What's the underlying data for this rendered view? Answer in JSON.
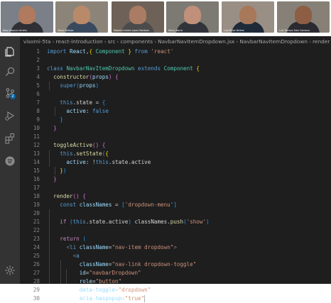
{
  "participants": [
    {
      "name": "Rosa Vasquez Arrieta",
      "bg": "#7a7f88",
      "skin": "#b07a5e",
      "shirt": "#2f2f35"
    },
    {
      "name": "Oscar Vallejos",
      "bg": "#8c8478",
      "skin": "#b98a6a",
      "shirt": "#3a4a5e"
    },
    {
      "name": "Roberto Andres Lopez Montano",
      "bg": "#6e6258",
      "skin": "#a97c63",
      "shirt": "#4b4b4b"
    },
    {
      "name": "Henry Ibarra",
      "bg": "#7d7a73",
      "skin": "#c0907a",
      "shirt": "#30343a"
    },
    {
      "name": "Luis Felipe Beltran",
      "bg": "#9a8f85",
      "skin": "#a8785b",
      "shirt": "#1f2a38"
    },
    {
      "name": "Luis Tamayo Soto Carrasco",
      "bg": "#868077",
      "skin": "#8d5e44",
      "shirt": "#2a2a30"
    }
  ],
  "breadcrumb": [
    "visomi-5ta",
    "react-introduction",
    "src",
    "components",
    "NavbarNavItemDropdown.jsx",
    "NavbarNavItemDropdown",
    "render"
  ],
  "activity_bar": [
    "files-icon",
    "search-icon",
    "source-control-icon",
    "run-debug-icon",
    "extensions-icon",
    "spotify-icon",
    "settings-gear-icon"
  ],
  "source_control_badge": "2",
  "code_lines": [
    {
      "n": "1",
      "tokens": [
        [
          "kw",
          "import "
        ],
        [
          "var",
          "React"
        ],
        [
          "",
          ","
        ],
        [
          "br1",
          "{ "
        ],
        [
          "cls",
          "Component"
        ],
        [
          "br1",
          " }"
        ],
        [
          "kw",
          " from "
        ],
        [
          "str",
          "'react'"
        ]
      ]
    },
    {
      "n": "2",
      "tokens": []
    },
    {
      "n": "3",
      "tokens": [
        [
          "kw",
          "class "
        ],
        [
          "cls",
          "NavbarNavItemDropdown"
        ],
        [
          "kw",
          " extends "
        ],
        [
          "cls",
          "Component"
        ],
        [
          "br1",
          " {"
        ]
      ]
    },
    {
      "n": "4",
      "tokens": [
        [
          "",
          "  "
        ],
        [
          "fn",
          "constructor"
        ],
        [
          "br2",
          "("
        ],
        [
          "var",
          "props"
        ],
        [
          "br2",
          ")"
        ],
        [
          "br2",
          " {"
        ]
      ]
    },
    {
      "n": "5",
      "tokens": [
        [
          "",
          "    "
        ],
        [
          "kw",
          "super"
        ],
        [
          "br3",
          "("
        ],
        [
          "var",
          "props"
        ],
        [
          "br3",
          ")"
        ]
      ]
    },
    {
      "n": "6",
      "tokens": []
    },
    {
      "n": "7",
      "tokens": [
        [
          "",
          "    "
        ],
        [
          "kw",
          "this"
        ],
        [
          "",
          ".state = "
        ],
        [
          "br3",
          "{"
        ]
      ]
    },
    {
      "n": "8",
      "tokens": [
        [
          "",
          "      "
        ],
        [
          "var",
          "active"
        ],
        [
          "",
          ": "
        ],
        [
          "kw",
          "false"
        ]
      ]
    },
    {
      "n": "9",
      "tokens": [
        [
          "",
          "    "
        ],
        [
          "br3",
          "}"
        ]
      ]
    },
    {
      "n": "10",
      "tokens": [
        [
          "",
          "  "
        ],
        [
          "br2",
          "}"
        ]
      ]
    },
    {
      "n": "11",
      "tokens": []
    },
    {
      "n": "12",
      "tokens": [
        [
          "",
          "  "
        ],
        [
          "fn",
          "toggleActive"
        ],
        [
          "br2",
          "()"
        ],
        [
          "br2",
          " {"
        ]
      ]
    },
    {
      "n": "13",
      "tokens": [
        [
          "",
          "    "
        ],
        [
          "kw",
          "this"
        ],
        [
          "",
          "."
        ],
        [
          "fn",
          "setState"
        ],
        [
          "br3",
          "("
        ],
        [
          "br1",
          "{"
        ]
      ]
    },
    {
      "n": "14",
      "tokens": [
        [
          "",
          "      "
        ],
        [
          "var",
          "active"
        ],
        [
          "",
          ": !"
        ],
        [
          "kw",
          "this"
        ],
        [
          "",
          ".state.active"
        ]
      ]
    },
    {
      "n": "15",
      "tokens": [
        [
          "",
          "    "
        ],
        [
          "br1",
          "}"
        ],
        [
          "br3",
          ")"
        ]
      ]
    },
    {
      "n": "16",
      "tokens": [
        [
          "",
          "  "
        ],
        [
          "br2",
          "}"
        ]
      ]
    },
    {
      "n": "17",
      "tokens": []
    },
    {
      "n": "18",
      "tokens": [
        [
          "",
          "  "
        ],
        [
          "fn",
          "render"
        ],
        [
          "br2",
          "()"
        ],
        [
          "br2",
          " {"
        ]
      ]
    },
    {
      "n": "19",
      "tokens": [
        [
          "",
          "    "
        ],
        [
          "kw",
          "const "
        ],
        [
          "var",
          "classNames"
        ],
        [
          "",
          " = "
        ],
        [
          "br3",
          "["
        ],
        [
          "str",
          "'dropdown-menu'"
        ],
        [
          "br3",
          "]"
        ]
      ]
    },
    {
      "n": "20",
      "tokens": []
    },
    {
      "n": "21",
      "tokens": [
        [
          "",
          "    "
        ],
        [
          "ctl",
          "if "
        ],
        [
          "br3",
          "("
        ],
        [
          "kw",
          "this"
        ],
        [
          "",
          ".state.active"
        ],
        [
          "br3",
          ")"
        ],
        [
          "",
          " classNames."
        ],
        [
          "fn",
          "push"
        ],
        [
          "br3",
          "("
        ],
        [
          "str",
          "'show'"
        ],
        [
          "br3",
          ")"
        ]
      ]
    },
    {
      "n": "22",
      "tokens": []
    },
    {
      "n": "23",
      "tokens": [
        [
          "",
          "    "
        ],
        [
          "ctl",
          "return "
        ],
        [
          "br3",
          "("
        ]
      ]
    },
    {
      "n": "24",
      "tokens": [
        [
          "",
          "      "
        ],
        [
          "pun",
          "<"
        ],
        [
          "tag",
          "li "
        ],
        [
          "var",
          "className"
        ],
        [
          "",
          "="
        ],
        [
          "str",
          "\"nav-item dropdown\""
        ],
        [
          "pun",
          ">"
        ]
      ]
    },
    {
      "n": "25",
      "tokens": [
        [
          "",
          "        "
        ],
        [
          "pun",
          "<"
        ],
        [
          "tag",
          "a"
        ]
      ]
    },
    {
      "n": "26",
      "tokens": [
        [
          "",
          "          "
        ],
        [
          "var",
          "className"
        ],
        [
          "",
          "="
        ],
        [
          "str",
          "\"nav-link dropdown-toggle\""
        ]
      ]
    },
    {
      "n": "27",
      "tokens": [
        [
          "",
          "          "
        ],
        [
          "var",
          "id"
        ],
        [
          "",
          "="
        ],
        [
          "str",
          "\"navbarDropdown\""
        ]
      ]
    },
    {
      "n": "28",
      "tokens": [
        [
          "",
          "          "
        ],
        [
          "var",
          "role"
        ],
        [
          "",
          "="
        ],
        [
          "str",
          "\"button\""
        ]
      ]
    },
    {
      "n": "29",
      "tokens": [
        [
          "",
          "          "
        ],
        [
          "var",
          "data-toggle"
        ],
        [
          "",
          "="
        ],
        [
          "str",
          "\"dropdown\""
        ]
      ]
    },
    {
      "n": "30",
      "tokens": [
        [
          "",
          "          "
        ],
        [
          "var",
          "aria-haspopup"
        ],
        [
          "",
          "="
        ],
        [
          "str",
          "\"true\""
        ]
      ]
    }
  ]
}
